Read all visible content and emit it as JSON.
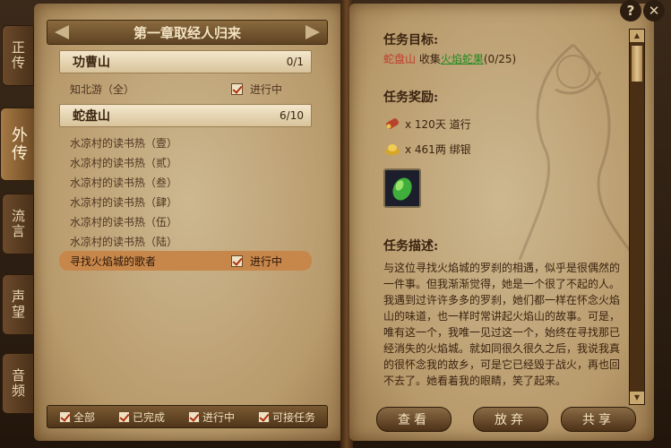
{
  "tabs": [
    {
      "label": "正传",
      "active": false
    },
    {
      "label": "外传",
      "active": true
    },
    {
      "label": "流言",
      "active": false
    },
    {
      "label": "声望",
      "active": false
    },
    {
      "label": "音频",
      "active": false
    }
  ],
  "chapter": {
    "title": "第一章取经人归来"
  },
  "quests": {
    "group1": {
      "name": "功曹山",
      "count": "0/1"
    },
    "group1_items": [
      {
        "name": "知北游（全）",
        "status": "进行中"
      }
    ],
    "group2": {
      "name": "蛇盘山",
      "count": "6/10"
    },
    "group2_items": [
      {
        "name": "水凉村的读书热（壹）"
      },
      {
        "name": "水凉村的读书热（贰）"
      },
      {
        "name": "水凉村的读书热（叁）"
      },
      {
        "name": "水凉村的读书热（肆）"
      },
      {
        "name": "水凉村的读书热（伍）"
      },
      {
        "name": "水凉村的读书热（陆）"
      },
      {
        "name": "寻找火焰城的歌者",
        "status": "进行中"
      }
    ]
  },
  "filters": [
    "全部",
    "已完成",
    "进行中",
    "可接任务"
  ],
  "detail": {
    "target_heading": "任务目标:",
    "target_location": "蛇盘山",
    "target_verb": "收集",
    "target_item": "火焰蛇果",
    "target_progress": "(0/25)",
    "reward_heading": "任务奖励:",
    "reward_1": "x 120天 道行",
    "reward_2": "x 461两 绑银",
    "desc_heading": "任务描述:",
    "description": "与这位寻找火焰城的罗刹的相遇，似乎是很偶然的一件事。但我渐渐觉得，她是一个很了不起的人。我遇到过许许多多的罗刹，她们都一样在怀念火焰山的味道，也一样时常讲起火焰山的故事。可是，唯有这一个，我唯一见过这一个，始终在寻找那已经消失的火焰城。就如同很久很久之后，我说我真的很怀念我的故乡，可是它已经毁于战火，再也回不去了。她看着我的眼睛，笑了起来。"
  },
  "buttons": {
    "view": "查看",
    "abandon": "放弃",
    "share": "共享"
  },
  "top_icons": {
    "help": "?",
    "close": "✕"
  }
}
